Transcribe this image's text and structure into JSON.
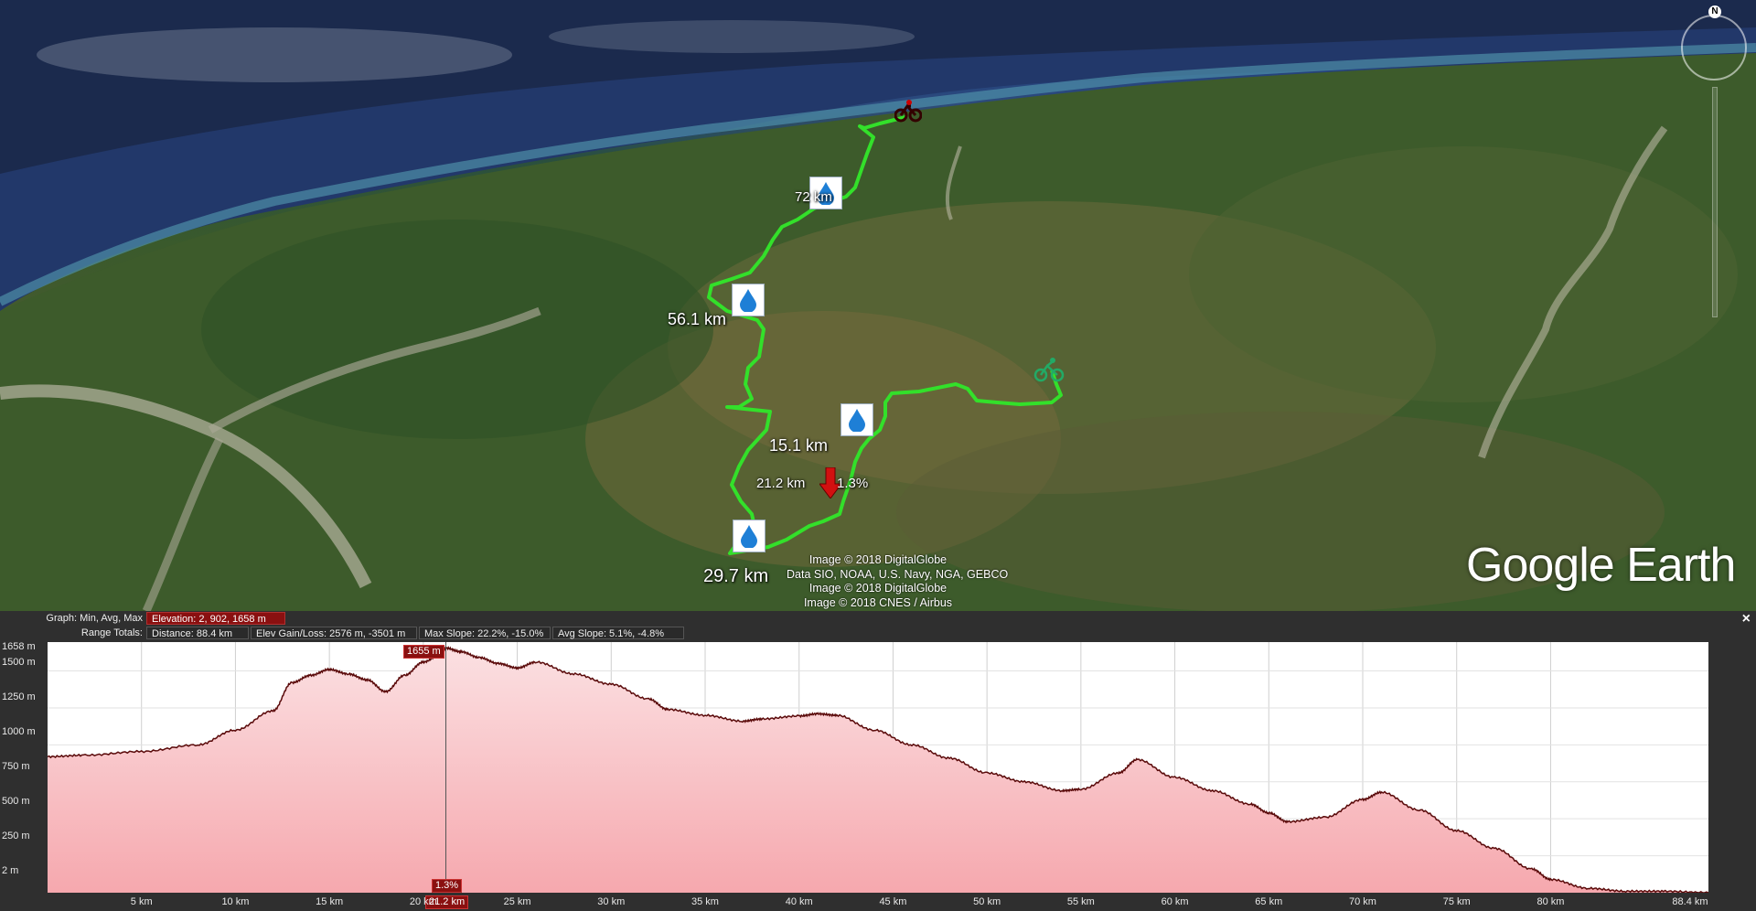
{
  "map": {
    "markers": [
      {
        "label": "72 km",
        "kind": "water"
      },
      {
        "label": "56.1 km",
        "kind": "water"
      },
      {
        "label": "15.1 km",
        "kind": "water"
      },
      {
        "label": "29.7 km",
        "kind": "water"
      }
    ],
    "cursor_label": {
      "distance": "21.2 km",
      "slope": "1.3%"
    },
    "credits": [
      "Image © 2018 DigitalGlobe",
      "Data SIO, NOAA, U.S. Navy, NGA, GEBCO",
      "Image © 2018 DigitalGlobe",
      "Image © 2018 CNES / Airbus"
    ],
    "logo": "Google Earth",
    "compass_label": "N",
    "route_color": "#33e02a",
    "water_icon_color": "#1e7fd6"
  },
  "elevation_panel": {
    "graph_label": "Graph: Min, Avg, Max",
    "elevation_readout": "Elevation: 2, 902, 1658 m",
    "range_totals_label": "Range Totals:",
    "distance": "Distance: 88.4 km",
    "elev_gain_loss": "Elev Gain/Loss: 2576 m, -3501 m",
    "max_slope": "Max Slope: 22.2%, -15.0%",
    "avg_slope": "Avg Slope: 5.1%, -4.8%",
    "close_label": "×",
    "cursor_elevation": "1655 m",
    "cursor_slope": "1.3%",
    "cursor_distance": "21.2 km",
    "y_ticks": [
      "1658 m",
      "1500 m",
      "1250 m",
      "1000 m",
      "750 m",
      "500 m",
      "250 m",
      "2 m"
    ],
    "x_ticks": [
      "5 km",
      "10 km",
      "15 km",
      "20 km",
      "25 km",
      "30 km",
      "35 km",
      "40 km",
      "45 km",
      "50 km",
      "55 km",
      "60 km",
      "65 km",
      "70 km",
      "75 km",
      "80 km",
      "88.4 km"
    ],
    "fill_color": "#f7b3b8",
    "line_color": "#5a0a0a"
  },
  "chart_data": {
    "type": "area",
    "title": "",
    "xlabel": "",
    "ylabel": "",
    "xlim": [
      0,
      88.4
    ],
    "ylim": [
      2,
      1658
    ],
    "x_unit": "km",
    "y_unit": "m",
    "series": [
      {
        "x": [
          0,
          2,
          5,
          8,
          10,
          12,
          13,
          14,
          15,
          16,
          17,
          18,
          19,
          20,
          21,
          21.2,
          22,
          23,
          24,
          25,
          26,
          28,
          30,
          32,
          33,
          35,
          37,
          38,
          40,
          41,
          42,
          44,
          46,
          48,
          50,
          52,
          54,
          55,
          57,
          58,
          60,
          62,
          64,
          65,
          66,
          68,
          70,
          71,
          73,
          75,
          77,
          79,
          80,
          82,
          84,
          86,
          88.4
        ],
        "y": [
          920,
          930,
          955,
          1000,
          1100,
          1230,
          1420,
          1470,
          1510,
          1480,
          1440,
          1360,
          1470,
          1560,
          1620,
          1655,
          1630,
          1590,
          1550,
          1520,
          1560,
          1480,
          1410,
          1310,
          1240,
          1200,
          1160,
          1175,
          1195,
          1210,
          1200,
          1100,
          1000,
          910,
          810,
          750,
          690,
          700,
          810,
          900,
          780,
          690,
          600,
          540,
          480,
          510,
          630,
          680,
          560,
          420,
          300,
          160,
          90,
          30,
          10,
          10,
          0
        ]
      }
    ]
  }
}
